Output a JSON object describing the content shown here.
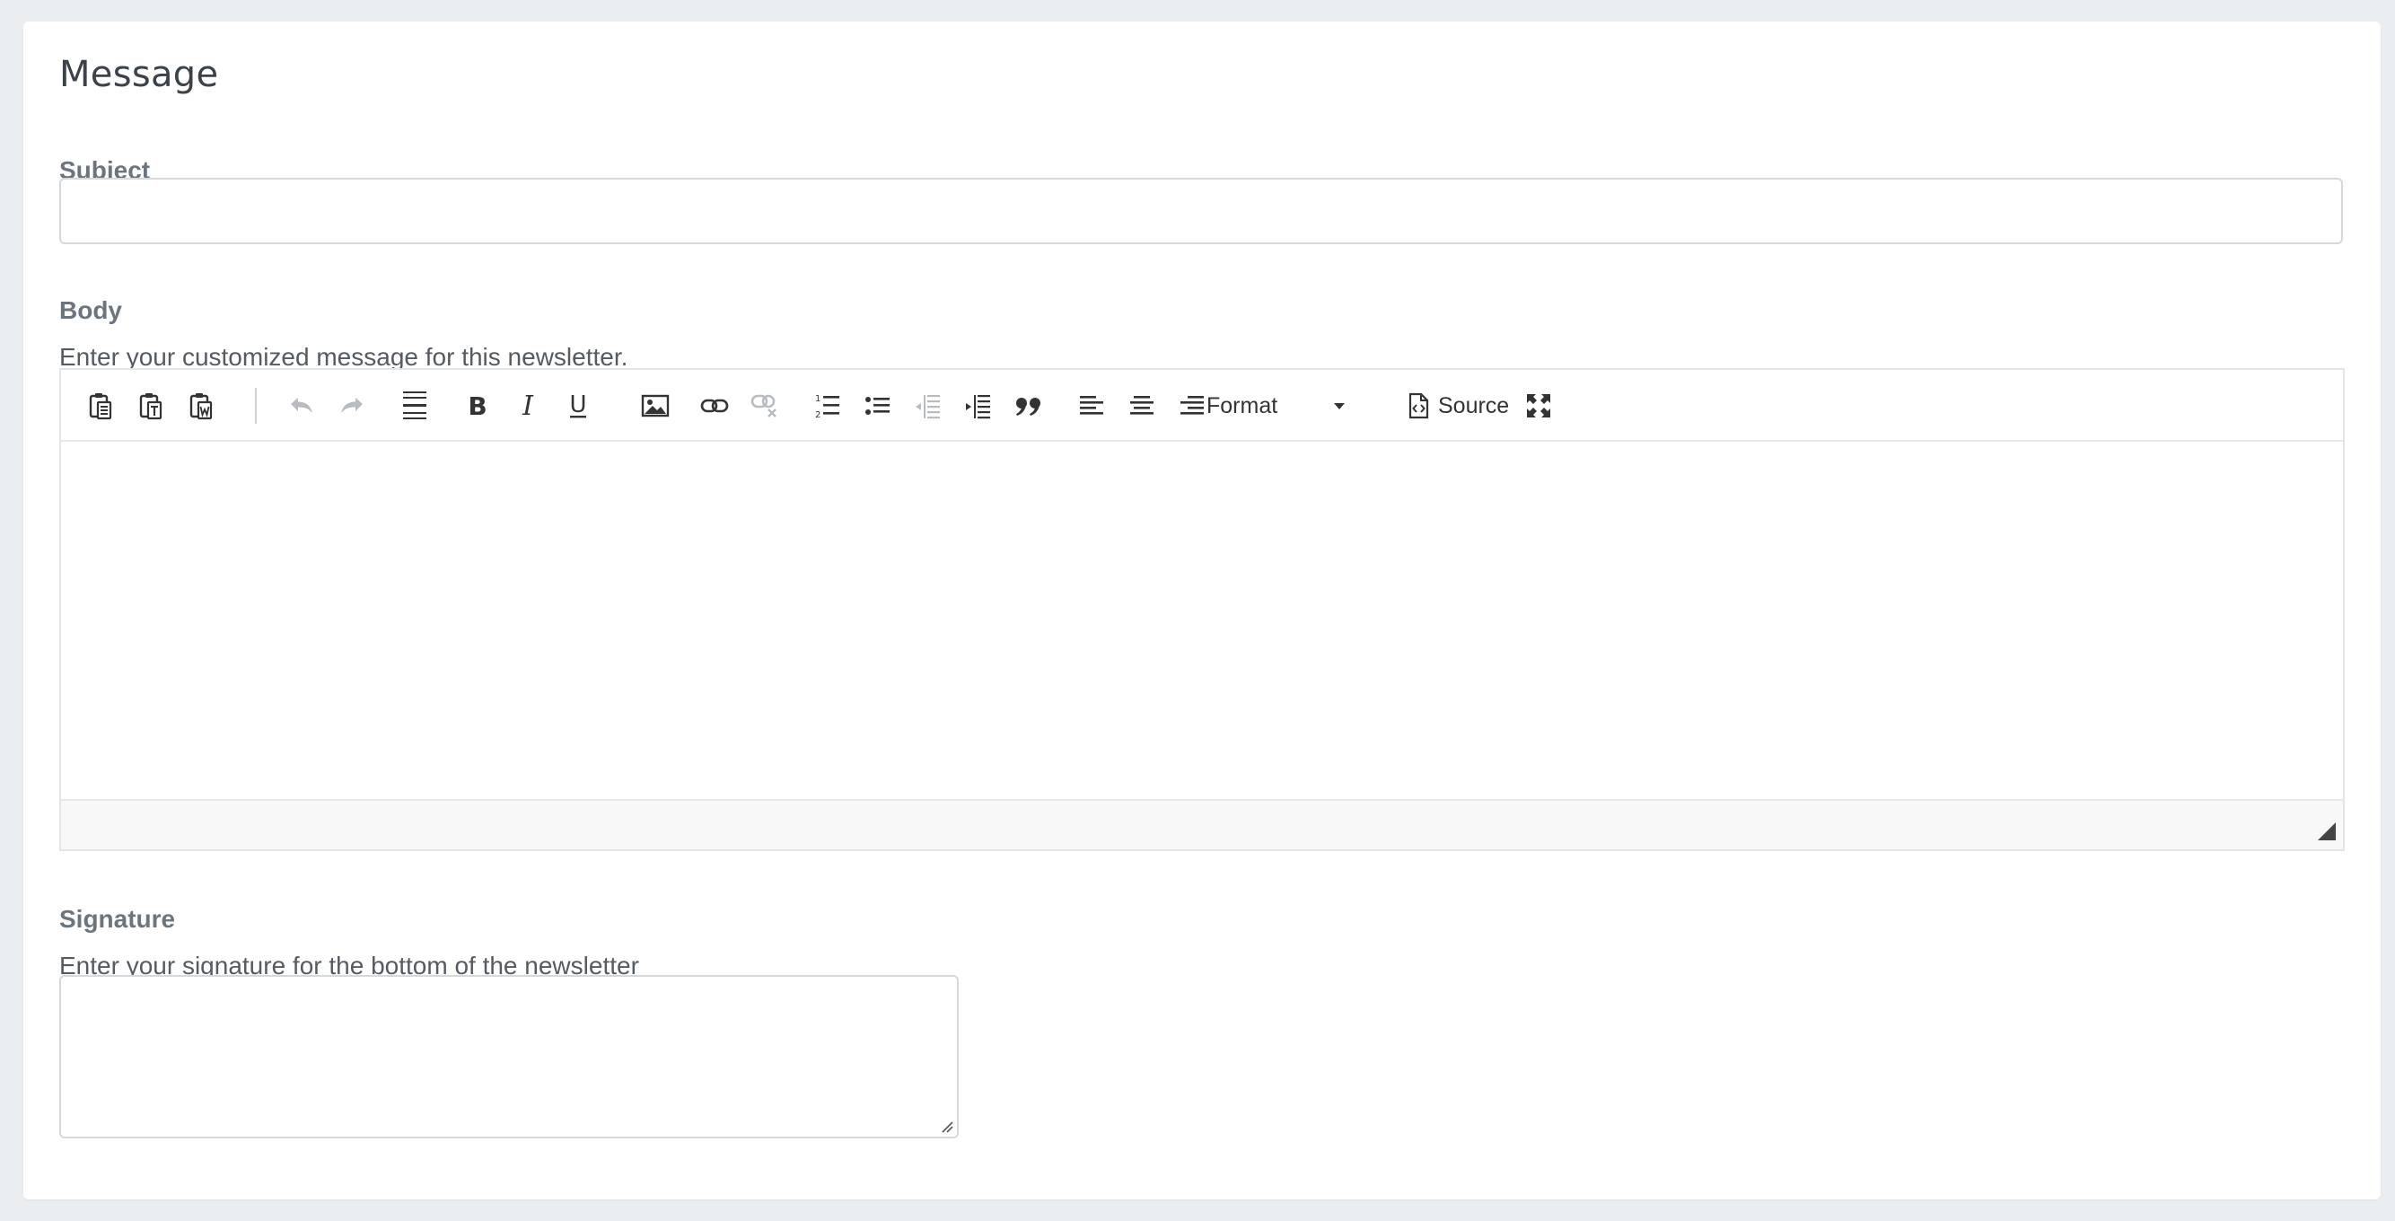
{
  "card": {
    "title": "Message"
  },
  "subject": {
    "label": "Subject",
    "value": "",
    "placeholder": ""
  },
  "body": {
    "label": "Body",
    "help": "Enter your customized message for this newsletter.",
    "toolbar": {
      "buttons": [
        {
          "name": "paste-icon"
        },
        {
          "name": "paste-text-icon"
        },
        {
          "name": "paste-word-icon"
        },
        {
          "name": "undo-icon"
        },
        {
          "name": "redo-icon"
        },
        {
          "name": "horizontal-rule-icon"
        },
        {
          "name": "bold-icon"
        },
        {
          "name": "italic-icon"
        },
        {
          "name": "underline-icon"
        },
        {
          "name": "image-icon"
        },
        {
          "name": "link-icon"
        },
        {
          "name": "unlink-icon"
        },
        {
          "name": "numbered-list-icon"
        },
        {
          "name": "bulleted-list-icon"
        },
        {
          "name": "outdent-icon"
        },
        {
          "name": "indent-icon"
        },
        {
          "name": "blockquote-icon"
        },
        {
          "name": "align-left-icon"
        },
        {
          "name": "align-center-icon"
        },
        {
          "name": "align-right-icon"
        }
      ],
      "format_label": "Format",
      "source_label": "Source"
    }
  },
  "signature": {
    "label": "Signature",
    "help": "Enter your signature for the bottom of the newsletter",
    "value": ""
  },
  "colors": {
    "page_bg": "#ebeef1",
    "card_bg": "#ffffff",
    "label": "#6c757d",
    "icon": "#333333",
    "icon_disabled": "#b8bcc0"
  }
}
